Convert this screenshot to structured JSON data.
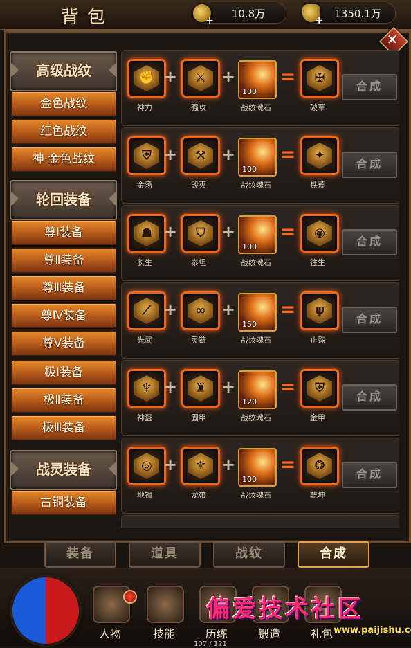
{
  "header": {
    "title": "背包",
    "coins": "10.8万",
    "ingots": "1350.1万"
  },
  "menu": {
    "categories": [
      {
        "label": "高级战纹",
        "items": [
          "金色战纹",
          "红色战纹",
          "神·金色战纹"
        ]
      },
      {
        "label": "轮回装备",
        "items": [
          "尊Ⅰ装备",
          "尊Ⅱ装备",
          "尊Ⅲ装备",
          "尊Ⅳ装备",
          "尊Ⅴ装备",
          "极Ⅰ装备",
          "极Ⅱ装备",
          "极Ⅲ装备"
        ]
      },
      {
        "label": "战灵装备",
        "items": [
          "古铜装备"
        ]
      }
    ]
  },
  "recipes": [
    {
      "a": "神力",
      "b": "强攻",
      "stone": "战纹魂石",
      "qty": "100",
      "result": "破军",
      "button": "合成"
    },
    {
      "a": "金汤",
      "b": "毁灭",
      "stone": "战纹魂石",
      "qty": "100",
      "result": "铁蒺",
      "button": "合成"
    },
    {
      "a": "长生",
      "b": "泰坦",
      "stone": "战纹魂石",
      "qty": "100",
      "result": "往生",
      "button": "合成"
    },
    {
      "a": "光武",
      "b": "灵链",
      "stone": "战纹魂石",
      "qty": "150",
      "result": "止殇",
      "button": "合成"
    },
    {
      "a": "神盔",
      "b": "固甲",
      "stone": "战纹魂石",
      "qty": "120",
      "result": "金甲",
      "button": "合成"
    },
    {
      "a": "地镯",
      "b": "龙带",
      "stone": "战纹魂石",
      "qty": "100",
      "result": "乾坤",
      "button": "合成"
    }
  ],
  "tabs": [
    "装备",
    "道具",
    "战纹",
    "合成"
  ],
  "active_tab": "合成",
  "bottom_nav": [
    "人物",
    "技能",
    "历练",
    "锻造",
    "礼包"
  ],
  "exp_text": "107 / 121",
  "watermark": {
    "text": "偏爱技术社区",
    "url": "www.paijishu.com"
  },
  "icons": {
    "close": "close-icon",
    "coin": "coin-icon",
    "ingot": "ingot-icon",
    "plus": "plus-icon"
  },
  "colors": {
    "accent": "#e68a2a",
    "slot_glow": "#e86a1a",
    "equals": "#ff6a1a"
  }
}
